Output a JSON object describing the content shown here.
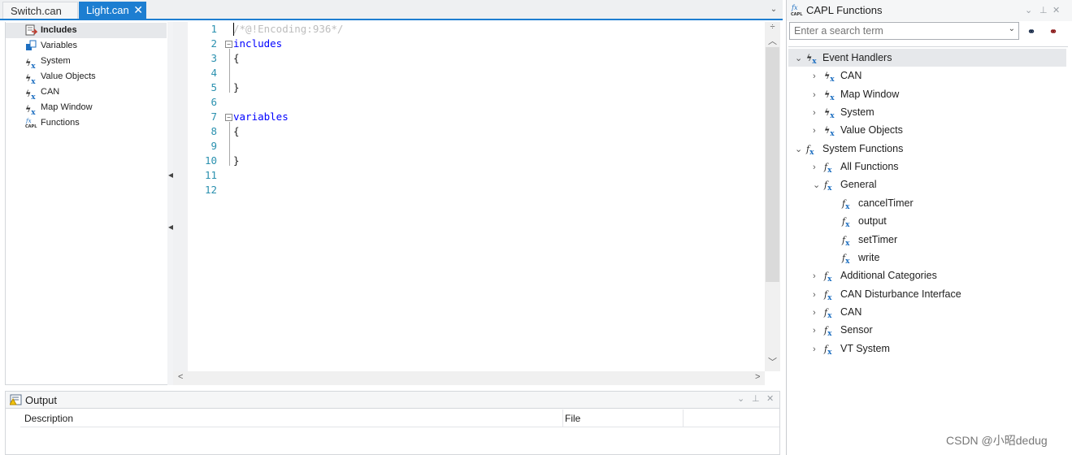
{
  "tabs": [
    {
      "label": "Switch.can",
      "active": false
    },
    {
      "label": "Light.can",
      "active": true
    }
  ],
  "left_tree": {
    "items": [
      {
        "label": "Includes",
        "icon": "includes-icon",
        "selected": true
      },
      {
        "label": "Variables",
        "icon": "variables-icon"
      },
      {
        "label": "System",
        "icon": "event-fx-icon"
      },
      {
        "label": "Value Objects",
        "icon": "event-fx-icon"
      },
      {
        "label": "CAN",
        "icon": "event-fx-icon"
      },
      {
        "label": "Map Window",
        "icon": "event-fx-icon"
      },
      {
        "label": "Functions",
        "icon": "capl-functions-icon"
      }
    ]
  },
  "editor": {
    "lines": [
      {
        "n": "1",
        "text": "/*@!Encoding:936*/"
      },
      {
        "n": "2",
        "text": "includes"
      },
      {
        "n": "3",
        "text": "{"
      },
      {
        "n": "4",
        "text": ""
      },
      {
        "n": "5",
        "text": "}"
      },
      {
        "n": "6",
        "text": ""
      },
      {
        "n": "7",
        "text": "variables"
      },
      {
        "n": "8",
        "text": "{"
      },
      {
        "n": "9",
        "text": ""
      },
      {
        "n": "10",
        "text": "}"
      },
      {
        "n": "11",
        "text": ""
      },
      {
        "n": "12",
        "text": ""
      }
    ]
  },
  "output": {
    "title": "Output",
    "columns": [
      "Description",
      "File"
    ]
  },
  "capl_panel": {
    "title": "CAPL Functions",
    "search_placeholder": "Enter a search term",
    "tree": [
      {
        "label": "Event Handlers",
        "level": 0,
        "chevron": "v",
        "icon": "event-fx-icon"
      },
      {
        "label": "CAN",
        "level": 1,
        "chevron": ">",
        "icon": "event-fx-icon"
      },
      {
        "label": "Map Window",
        "level": 1,
        "chevron": ">",
        "icon": "event-fx-icon"
      },
      {
        "label": "System",
        "level": 1,
        "chevron": ">",
        "icon": "event-fx-icon"
      },
      {
        "label": "Value Objects",
        "level": 1,
        "chevron": ">",
        "icon": "event-fx-icon"
      },
      {
        "label": "System Functions",
        "level": 0,
        "chevron": "v",
        "icon": "fx-icon"
      },
      {
        "label": "All Functions",
        "level": 1,
        "chevron": ">",
        "icon": "fx-icon"
      },
      {
        "label": "General",
        "level": 1,
        "chevron": "v",
        "icon": "fx-icon"
      },
      {
        "label": "cancelTimer",
        "level": 2,
        "chevron": "",
        "icon": "fx-icon"
      },
      {
        "label": "output",
        "level": 2,
        "chevron": "",
        "icon": "fx-icon"
      },
      {
        "label": "setTimer",
        "level": 2,
        "chevron": "",
        "icon": "fx-icon"
      },
      {
        "label": "write",
        "level": 2,
        "chevron": "",
        "icon": "fx-icon"
      },
      {
        "label": "Additional Categories",
        "level": 1,
        "chevron": ">",
        "icon": "fx-icon"
      },
      {
        "label": "CAN Disturbance Interface",
        "level": 1,
        "chevron": ">",
        "icon": "fx-icon"
      },
      {
        "label": "CAN",
        "level": 1,
        "chevron": ">",
        "icon": "fx-icon"
      },
      {
        "label": "Sensor",
        "level": 1,
        "chevron": ">",
        "icon": "fx-icon"
      },
      {
        "label": "VT System",
        "level": 1,
        "chevron": ">",
        "icon": "fx-icon"
      }
    ]
  },
  "watermark": "CSDN @小昭dedug",
  "colors": {
    "accent": "#1d7ed1",
    "keyword": "#0000ff",
    "line_number": "#2b91af",
    "comment": "#bdbdbd"
  }
}
